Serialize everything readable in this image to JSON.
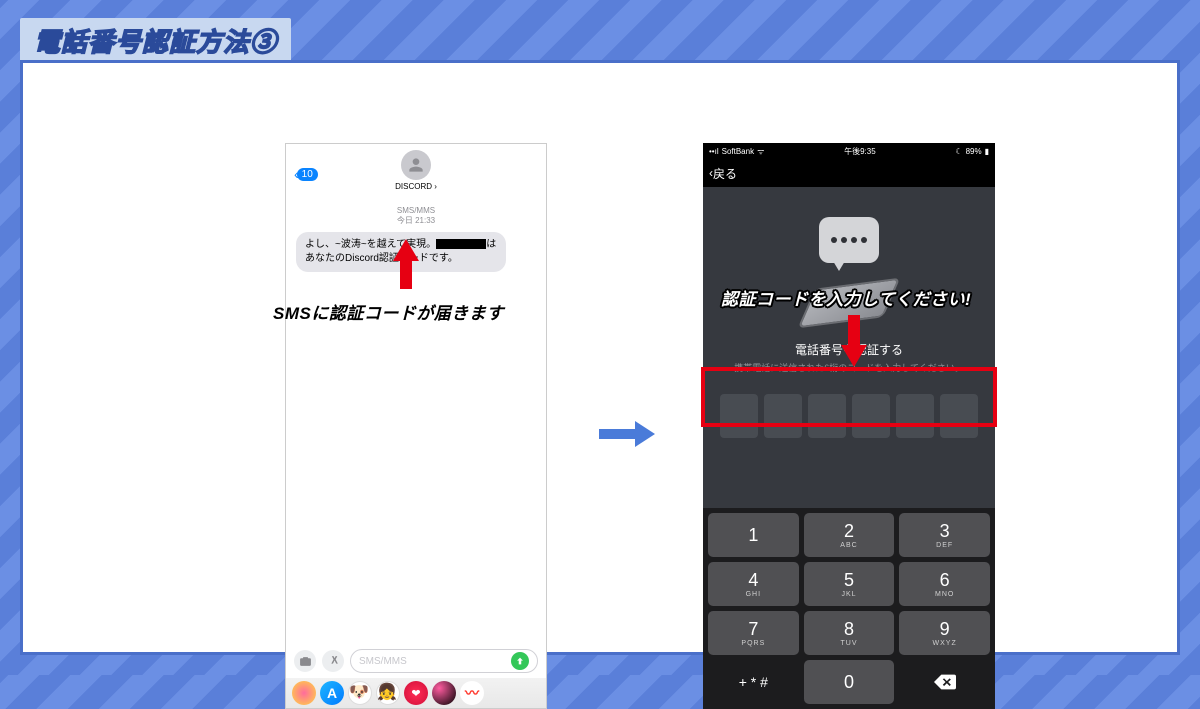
{
  "title": "電話番号認証方法③",
  "annotations": {
    "sms_arrives": "SMSに認証コードが届きます",
    "enter_code": "認証コードを入力してください!"
  },
  "left_phone": {
    "back_count": "10",
    "contact": "DISCORD ›",
    "meta_type": "SMS/MMS",
    "meta_time": "今日 21:33",
    "bubble_prefix": "よし、~波涛~を越えて実現。",
    "bubble_suffix": "はあなたのDiscord認証コードです。",
    "input_placeholder": "SMS/MMS"
  },
  "right_phone": {
    "status": {
      "carrier": "SoftBank",
      "wifi": "ᯤ",
      "time": "午後9:35",
      "dnd": "☾",
      "battery": "89%"
    },
    "back": "戻る",
    "heading": "電話番号を認証する",
    "sub": "携帯電話に送信された6桁のコードを入力してください。",
    "keys": [
      {
        "n": "1",
        "s": ""
      },
      {
        "n": "2",
        "s": "ABC"
      },
      {
        "n": "3",
        "s": "DEF"
      },
      {
        "n": "4",
        "s": "GHI"
      },
      {
        "n": "5",
        "s": "JKL"
      },
      {
        "n": "6",
        "s": "MNO"
      },
      {
        "n": "7",
        "s": "PQRS"
      },
      {
        "n": "8",
        "s": "TUV"
      },
      {
        "n": "9",
        "s": "WXYZ"
      }
    ],
    "sym": "+ * #",
    "zero": "0"
  }
}
